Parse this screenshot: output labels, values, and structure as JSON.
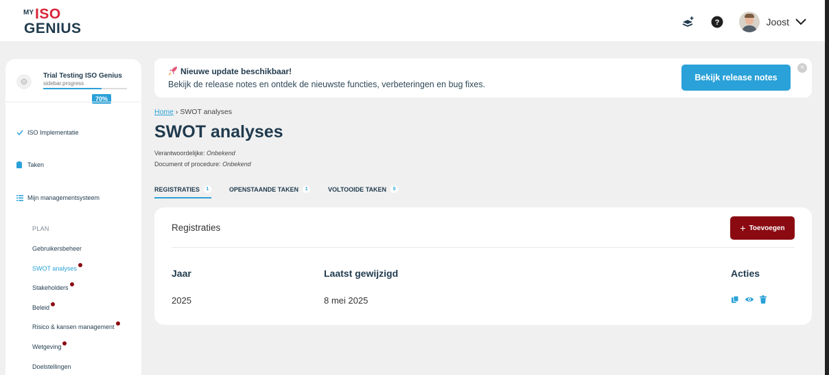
{
  "header": {
    "logo": {
      "my": "MY",
      "iso": "ISO",
      "genius": "GENIUS"
    },
    "icons": [
      "layers-plus-icon",
      "help-icon"
    ],
    "user": {
      "name": "Joost"
    }
  },
  "sidebar": {
    "trial": {
      "title": "Trial Testing ISO Genius",
      "subtitle": "sidebar.progress",
      "progress_label": "70%",
      "progress": 0.7
    },
    "nav": [
      {
        "label": "ISO Implementatie",
        "icon": "check-icon"
      },
      {
        "label": "Taken",
        "icon": "clipboard-icon"
      },
      {
        "label": "Mijn managementsysteem",
        "icon": "list-icon"
      }
    ],
    "section_label": "PLAN",
    "sub_items": [
      {
        "label": "Gebruikersbeheer",
        "dot": false,
        "active": false
      },
      {
        "label": "SWOT analyses",
        "dot": true,
        "active": true
      },
      {
        "label": "Stakeholders",
        "dot": true,
        "active": false
      },
      {
        "label": "Beleid",
        "dot": true,
        "active": false
      },
      {
        "label": "Risico & kansen management",
        "dot": true,
        "active": false
      },
      {
        "label": "Wetgeving",
        "dot": true,
        "active": false
      },
      {
        "label": "Doelstellingen",
        "dot": false,
        "active": false
      }
    ]
  },
  "banner": {
    "title": "Nieuwe update beschikbaar!",
    "text": "Bekijk de release notes en ontdek de nieuwste functies, verbeteringen en bug fixes.",
    "button_label": "Bekijk release notes"
  },
  "breadcrumb": {
    "home": "Home",
    "separator": " › ",
    "current": "SWOT analyses"
  },
  "page": {
    "title": "SWOT analyses",
    "responsible_label": "Verantwoordelijke: ",
    "responsible_value": "Onbekend",
    "document_label": "Document of procedure: ",
    "document_value": "Onbekend"
  },
  "tabs": [
    {
      "label": "REGISTRATIES",
      "count": "1",
      "active": true
    },
    {
      "label": "OPENSTAANDE TAKEN",
      "count": "1",
      "active": false
    },
    {
      "label": "VOLTOOIDE TAKEN",
      "count": "0",
      "active": false
    }
  ],
  "card": {
    "title": "Registraties",
    "add_label": "Toevoegen",
    "columns": {
      "year": "Jaar",
      "modified": "Laatst gewijzigd",
      "actions": "Acties"
    },
    "rows": [
      {
        "year": "2025",
        "modified": "8 mei 2025"
      }
    ]
  },
  "colors": {
    "accent": "#2aa1d8",
    "primary": "#1f3a4d",
    "danger": "#8b0a12"
  }
}
